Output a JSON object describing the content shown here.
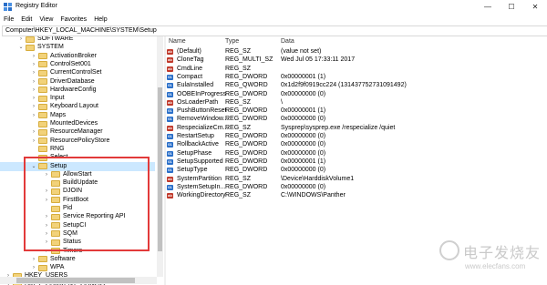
{
  "window": {
    "title": "Registry Editor",
    "controls": [
      "—",
      "☐",
      "✕"
    ]
  },
  "menu": [
    "File",
    "Edit",
    "View",
    "Favorites",
    "Help"
  ],
  "address": "Computer\\HKEY_LOCAL_MACHINE\\SYSTEM\\Setup",
  "tree": [
    {
      "label": "SOFTWARE",
      "level": 1,
      "arrow": "›"
    },
    {
      "label": "SYSTEM",
      "level": 1,
      "arrow": "⌄"
    },
    {
      "label": "ActivationBroker",
      "level": 2,
      "arrow": "›"
    },
    {
      "label": "ControlSet001",
      "level": 2,
      "arrow": "›"
    },
    {
      "label": "CurrentControlSet",
      "level": 2,
      "arrow": "›"
    },
    {
      "label": "DriverDatabase",
      "level": 2,
      "arrow": "›"
    },
    {
      "label": "HardwareConfig",
      "level": 2,
      "arrow": "›"
    },
    {
      "label": "Input",
      "level": 2,
      "arrow": "›"
    },
    {
      "label": "Keyboard Layout",
      "level": 2,
      "arrow": "›"
    },
    {
      "label": "Maps",
      "level": 2,
      "arrow": "›"
    },
    {
      "label": "MountedDevices",
      "level": 2,
      "arrow": ""
    },
    {
      "label": "ResourceManager",
      "level": 2,
      "arrow": "›"
    },
    {
      "label": "ResourcePolicyStore",
      "level": 2,
      "arrow": "›"
    },
    {
      "label": "RNG",
      "level": 2,
      "arrow": ""
    },
    {
      "label": "Select",
      "level": 2,
      "arrow": ""
    },
    {
      "label": "Setup",
      "level": 2,
      "arrow": "⌄",
      "selected": true
    },
    {
      "label": "AllowStart",
      "level": 3,
      "arrow": "›"
    },
    {
      "label": "BuildUpdate",
      "level": 3,
      "arrow": ""
    },
    {
      "label": "DJOIN",
      "level": 3,
      "arrow": "›"
    },
    {
      "label": "FirstBoot",
      "level": 3,
      "arrow": "›"
    },
    {
      "label": "Pid",
      "level": 3,
      "arrow": ""
    },
    {
      "label": "Service Reporting API",
      "level": 3,
      "arrow": "›"
    },
    {
      "label": "SetupCI",
      "level": 3,
      "arrow": "›"
    },
    {
      "label": "SQM",
      "level": 3,
      "arrow": "›"
    },
    {
      "label": "Status",
      "level": 3,
      "arrow": "›"
    },
    {
      "label": "Timers",
      "level": 3,
      "arrow": "›"
    },
    {
      "label": "Software",
      "level": 2,
      "arrow": "›"
    },
    {
      "label": "WPA",
      "level": 2,
      "arrow": "›"
    },
    {
      "label": "HKEY_USERS",
      "level": 0,
      "arrow": "›"
    },
    {
      "label": "HKEY_CURRENT_CONFIG",
      "level": 0,
      "arrow": "›"
    }
  ],
  "columns": {
    "name": "Name",
    "type": "Type",
    "data": "Data"
  },
  "values": [
    {
      "name": "(Default)",
      "type": "REG_SZ",
      "data": "(value not set)",
      "icon": "ab"
    },
    {
      "name": "CloneTag",
      "type": "REG_MULTI_SZ",
      "data": "Wed Jul 05 17:33:11 2017",
      "icon": "ab"
    },
    {
      "name": "CmdLine",
      "type": "REG_SZ",
      "data": "",
      "icon": "ab"
    },
    {
      "name": "Compact",
      "type": "REG_DWORD",
      "data": "0x00000001 (1)",
      "icon": "bin"
    },
    {
      "name": "EulaInstalled",
      "type": "REG_QWORD",
      "data": "0x1d2f9f0919cc224 (131437752731091492)",
      "icon": "bin"
    },
    {
      "name": "OOBEInProgress",
      "type": "REG_DWORD",
      "data": "0x00000000 (0)",
      "icon": "bin"
    },
    {
      "name": "OsLoaderPath",
      "type": "REG_SZ",
      "data": "\\",
      "icon": "ab"
    },
    {
      "name": "PushButtonReset",
      "type": "REG_DWORD",
      "data": "0x00000001 (1)",
      "icon": "bin"
    },
    {
      "name": "RemoveWindow...",
      "type": "REG_DWORD",
      "data": "0x00000000 (0)",
      "icon": "bin"
    },
    {
      "name": "RespecializeCm...",
      "type": "REG_SZ",
      "data": "Sysprep\\sysprep.exe /respecialize /quiet",
      "icon": "ab"
    },
    {
      "name": "RestartSetup",
      "type": "REG_DWORD",
      "data": "0x00000000 (0)",
      "icon": "bin"
    },
    {
      "name": "RollbackActive",
      "type": "REG_DWORD",
      "data": "0x00000000 (0)",
      "icon": "bin"
    },
    {
      "name": "SetupPhase",
      "type": "REG_DWORD",
      "data": "0x00000000 (0)",
      "icon": "bin"
    },
    {
      "name": "SetupSupported",
      "type": "REG_DWORD",
      "data": "0x00000001 (1)",
      "icon": "bin"
    },
    {
      "name": "SetupType",
      "type": "REG_DWORD",
      "data": "0x00000000 (0)",
      "icon": "bin"
    },
    {
      "name": "SystemPartition",
      "type": "REG_SZ",
      "data": "\\Device\\HarddiskVolume1",
      "icon": "ab"
    },
    {
      "name": "SystemSetupIn...",
      "type": "REG_DWORD",
      "data": "0x00000000 (0)",
      "icon": "bin"
    },
    {
      "name": "WorkingDirectory",
      "type": "REG_SZ",
      "data": "C:\\WINDOWS\\Panther",
      "icon": "ab"
    }
  ],
  "watermark": {
    "big": "电子发烧友",
    "small": "www.elecfans.com"
  },
  "colors": {
    "highlight_border": "#e23a3a",
    "folder": "#f2d27a",
    "selected_row": "#cce8ff"
  }
}
